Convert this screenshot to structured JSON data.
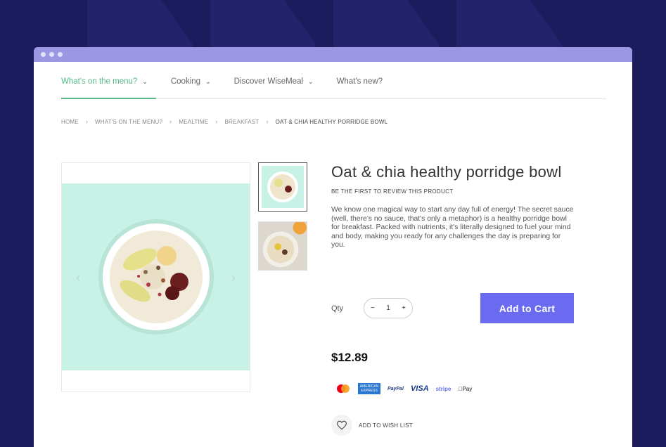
{
  "nav": {
    "items": [
      {
        "label": "What's on the menu?",
        "active": true
      },
      {
        "label": "Cooking",
        "active": false
      },
      {
        "label": "Discover WiseMeal",
        "active": false
      },
      {
        "label": "What's new?",
        "active": false
      }
    ],
    "accent_color": "#55b988"
  },
  "breadcrumb": [
    "HOME",
    "WHAT'S ON THE MENU?",
    "MEALTIME",
    "BREAKFAST",
    "OAT & CHIA HEALTHY PORRIDGE BOWL"
  ],
  "product": {
    "title": "Oat & chia healthy porridge bowl",
    "review_link": "BE THE FIRST TO REVIEW THIS PRODUCT",
    "description": "We know one magical way to start any day full of energy! The secret sauce (well, there's no sauce, that's only a metaphor) is a healthy porridge bowl for breakfast. Packed with nutrients, it's literally designed to fuel your mind and body, making you ready for any challenges the day is preparing for you.",
    "qty_label": "Qty",
    "qty_value": "1",
    "add_to_cart": "Add to Cart",
    "price": "$12.89",
    "wishlist": "ADD TO WISH LIST"
  },
  "payments": {
    "amex": "AMERICAN EXPRESS",
    "paypal": "PayPal",
    "visa": "VISA",
    "stripe": "stripe",
    "applepay": "Pay"
  },
  "colors": {
    "background": "#1c1b5e",
    "titlebar": "#9b97e3",
    "button": "#6a6bf0",
    "image_bg": "#c9f2e6"
  }
}
